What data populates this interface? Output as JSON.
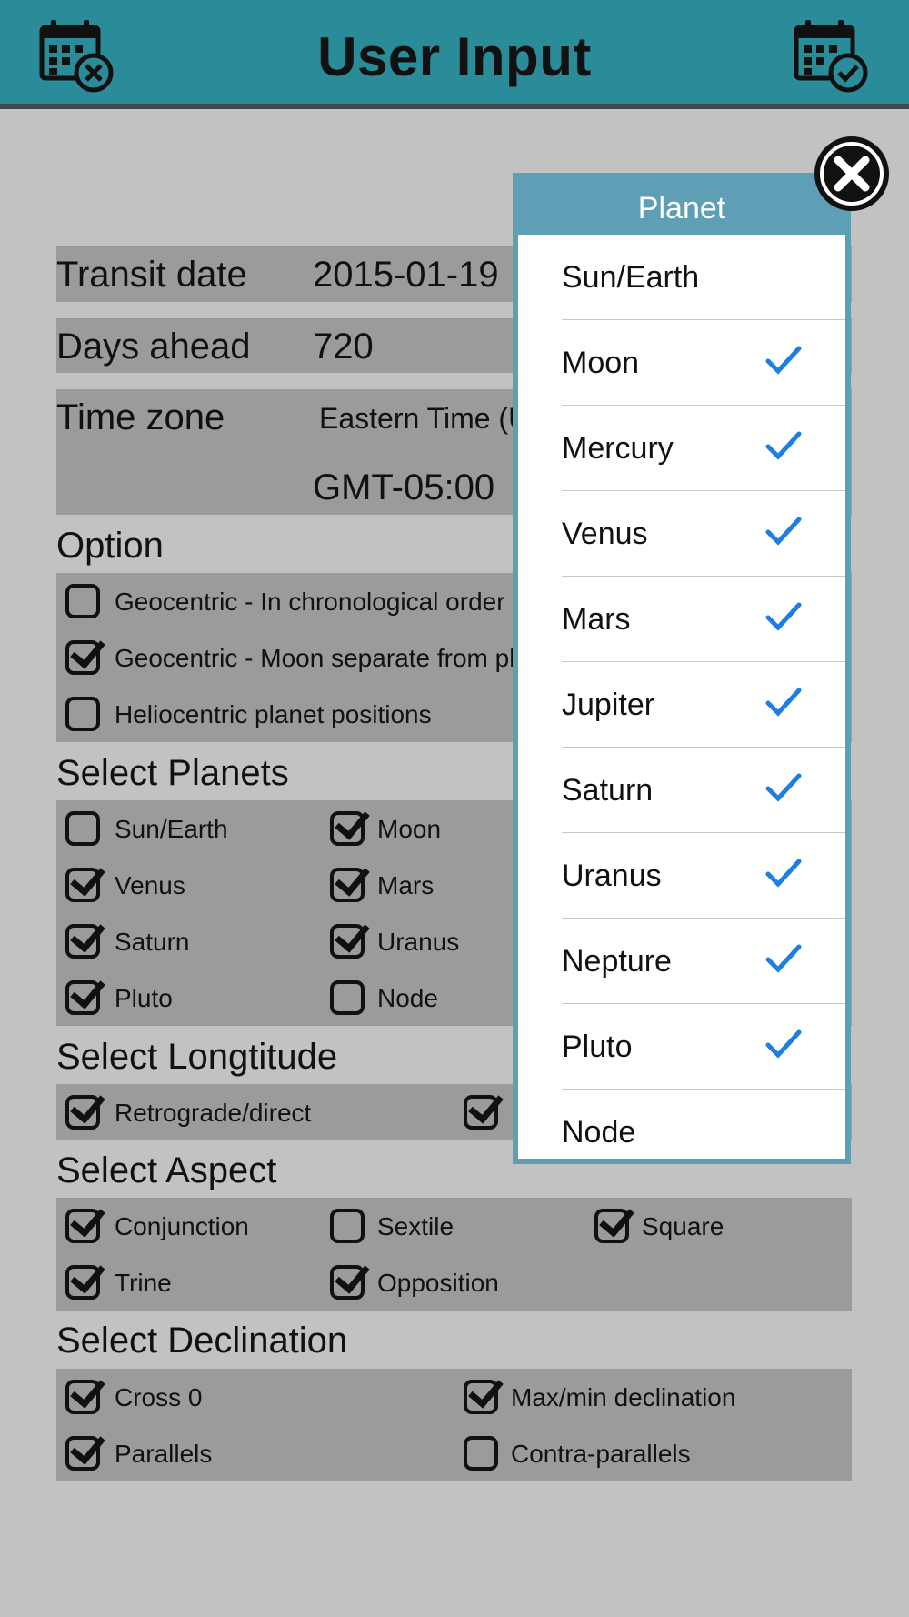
{
  "header": {
    "title": "User Input",
    "left_icon": "calendar-cancel-icon",
    "right_icon": "calendar-confirm-icon"
  },
  "fields": {
    "transit_date": {
      "label": "Transit date",
      "value": "2015-01-19"
    },
    "days_ahead": {
      "label": "Days ahead",
      "value": "720"
    },
    "time_zone": {
      "label": "Time zone",
      "value": "Eastern Time (US",
      "offset": "GMT-05:00"
    }
  },
  "option": {
    "title": "Option",
    "items": [
      {
        "label": "Geocentric - In chronological order",
        "checked": false
      },
      {
        "label": "Geocentric - Moon separate from plane",
        "checked": true
      },
      {
        "label": "Heliocentric planet positions",
        "checked": false
      }
    ]
  },
  "planets": {
    "title": "Select Planets",
    "items": [
      {
        "label": "Sun/Earth",
        "checked": false
      },
      {
        "label": "Moon",
        "checked": true
      },
      {
        "label": "Venus",
        "checked": true
      },
      {
        "label": "Mars",
        "checked": true
      },
      {
        "label": "Saturn",
        "checked": true
      },
      {
        "label": "Uranus",
        "checked": true
      },
      {
        "label": "Pluto",
        "checked": true
      },
      {
        "label": "Node",
        "checked": false
      }
    ]
  },
  "longitude": {
    "title": "Select Longtitude",
    "items": [
      {
        "label": "Retrograde/direct",
        "checked": true
      },
      {
        "label": "",
        "checked": true
      }
    ]
  },
  "aspect": {
    "title": "Select Aspect",
    "items": [
      {
        "label": "Conjunction",
        "checked": true
      },
      {
        "label": "Sextile",
        "checked": false
      },
      {
        "label": "Square",
        "checked": true
      },
      {
        "label": "Trine",
        "checked": true
      },
      {
        "label": "Opposition",
        "checked": true
      }
    ]
  },
  "declination": {
    "title": "Select Declination",
    "items": [
      {
        "label": "Cross 0",
        "checked": true
      },
      {
        "label": "Max/min declination",
        "checked": true
      },
      {
        "label": "Parallels",
        "checked": true
      },
      {
        "label": "Contra-parallels",
        "checked": false
      }
    ]
  },
  "planet_popup": {
    "title": "Planet",
    "close_icon": "close-circle-icon",
    "items": [
      {
        "label": "Sun/Earth",
        "selected": false
      },
      {
        "label": "Moon",
        "selected": true
      },
      {
        "label": "Mercury",
        "selected": true
      },
      {
        "label": "Venus",
        "selected": true
      },
      {
        "label": "Mars",
        "selected": true
      },
      {
        "label": "Jupiter",
        "selected": true
      },
      {
        "label": "Saturn",
        "selected": true
      },
      {
        "label": "Uranus",
        "selected": true
      },
      {
        "label": "Nepture",
        "selected": true
      },
      {
        "label": "Pluto",
        "selected": true
      },
      {
        "label": "Node",
        "selected": false
      }
    ]
  },
  "colors": {
    "header": "#2b8c99",
    "background": "#c2c2c2",
    "row": "#9b9b9b",
    "popup": "#5e9fb6",
    "tick": "#1f7fe0"
  }
}
